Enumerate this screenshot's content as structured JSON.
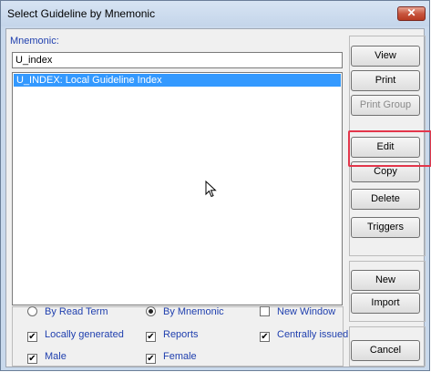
{
  "window": {
    "title": "Select Guideline by Mnemonic",
    "close_symbol": "✕"
  },
  "mnemonic": {
    "label": "Mnemonic:",
    "value": "U_index"
  },
  "list": {
    "items": [
      {
        "label": "U_INDEX: Local Guideline Index",
        "selected": true
      }
    ]
  },
  "buttons": {
    "view": "View",
    "print": "Print",
    "print_group": "Print Group",
    "edit": "Edit",
    "copy": "Copy",
    "delete": "Delete",
    "triggers": "Triggers",
    "new": "New",
    "import": "Import",
    "cancel": "Cancel"
  },
  "options": {
    "by_read_term": {
      "label": "By Read Term",
      "checked": false
    },
    "by_mnemonic": {
      "label": "By Mnemonic",
      "checked": true
    },
    "new_window": {
      "label": "New Window",
      "checked": false
    },
    "locally_generated": {
      "label": "Locally generated",
      "checked": true
    },
    "reports": {
      "label": "Reports",
      "checked": true
    },
    "centrally_issued": {
      "label": "Centrally issued",
      "checked": true
    },
    "male": {
      "label": "Male",
      "checked": true
    },
    "female": {
      "label": "Female",
      "checked": true
    }
  },
  "colors": {
    "selection": "#3399ff",
    "label_blue": "#1f3fae",
    "highlight": "#e3364b"
  },
  "icons": {
    "close": "close-icon",
    "cursor": "mouse-pointer-icon"
  }
}
